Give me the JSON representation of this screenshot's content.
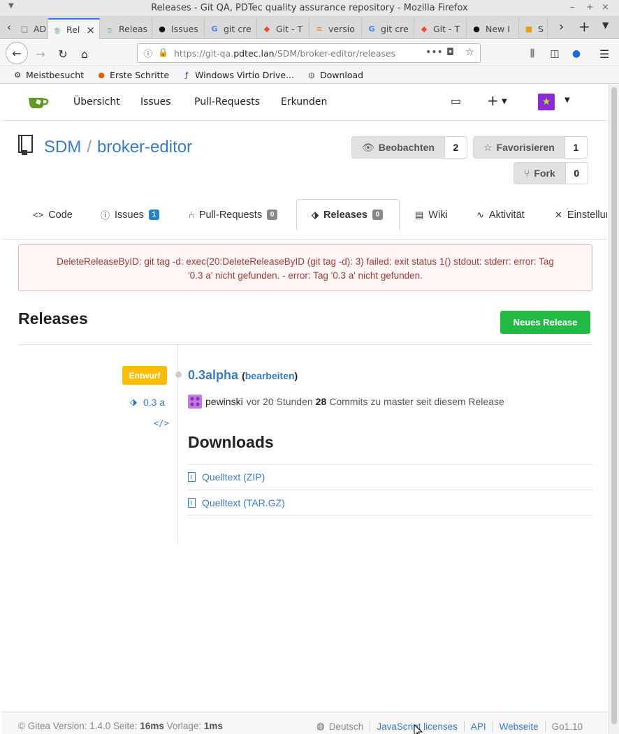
{
  "window": {
    "title": "Releases - Git QA, PDTec quality assurance repository - Mozilla Firefox"
  },
  "tabs": [
    {
      "label": "ADM"
    },
    {
      "label": "Rel"
    },
    {
      "label": "Releas"
    },
    {
      "label": "Issues"
    },
    {
      "label": "git cre"
    },
    {
      "label": "Git - T"
    },
    {
      "label": "versio"
    },
    {
      "label": "git cre"
    },
    {
      "label": "Git - T"
    },
    {
      "label": "New I"
    },
    {
      "label": "S"
    }
  ],
  "urlbar": {
    "prefix": "https://git-qa.",
    "domain": "pdtec.lan",
    "path": "/SDM/broker-editor/releases"
  },
  "bookmarks": [
    {
      "label": "Meistbesucht",
      "icon": "gear-icon"
    },
    {
      "label": "Erste Schritte",
      "icon": "firefox-icon"
    },
    {
      "label": "Windows Virtio Drive...",
      "icon": "fedora-icon"
    },
    {
      "label": "Download",
      "icon": "globe-icon"
    }
  ],
  "gitea_nav": {
    "items": [
      "Übersicht",
      "Issues",
      "Pull-Requests",
      "Erkunden"
    ]
  },
  "repo": {
    "owner": "SDM",
    "name": "broker-editor",
    "watch": {
      "label": "Beobachten",
      "count": "2"
    },
    "star": {
      "label": "Favorisieren",
      "count": "1"
    },
    "fork": {
      "label": "Fork",
      "count": "0"
    }
  },
  "repo_tabs": [
    {
      "label": "Code"
    },
    {
      "label": "Issues",
      "badge": "1"
    },
    {
      "label": "Pull-Requests",
      "badge": "0"
    },
    {
      "label": "Releases",
      "badge": "0"
    },
    {
      "label": "Wiki"
    },
    {
      "label": "Aktivität"
    },
    {
      "label": "Einstellun"
    }
  ],
  "error": {
    "line1": "DeleteReleaseByID: git tag -d: exec(20:DeleteReleaseByID (git tag -d): 3) failed: exit status 1() stdout: stderr: error: Tag",
    "line2": "'0.3 a' nicht gefunden. - error: Tag '0.3 a' nicht gefunden."
  },
  "releases": {
    "heading": "Releases",
    "new_button": "Neues Release",
    "item": {
      "draft_label": "Entwurf",
      "tag": "0.3 a",
      "title": "0.3alpha",
      "edit_label": "bearbeiten",
      "user": "pewinski",
      "time": "vor 20 Stunden",
      "commits": "28",
      "commits_suffix": "Commits zu master seit diesem Release",
      "downloads_heading": "Downloads",
      "downloads": [
        "Quelltext (ZIP)",
        "Quelltext (TAR.GZ)"
      ]
    }
  },
  "footer": {
    "version_prefix": "© Gitea Version: 1.4.0 Seite:",
    "page_time": "16ms",
    "tpl_prefix": "Vorlage:",
    "tpl_time": "1ms",
    "language": "Deutsch",
    "links": [
      "JavaScript licenses",
      "API",
      "Webseite"
    ],
    "go": "Go1.10"
  },
  "colors": {
    "accent": "#3a7bc8",
    "green": "#21ba45",
    "draft": "#fbbd08",
    "error_text": "#9f3a38",
    "error_bg": "#fff6f6"
  }
}
